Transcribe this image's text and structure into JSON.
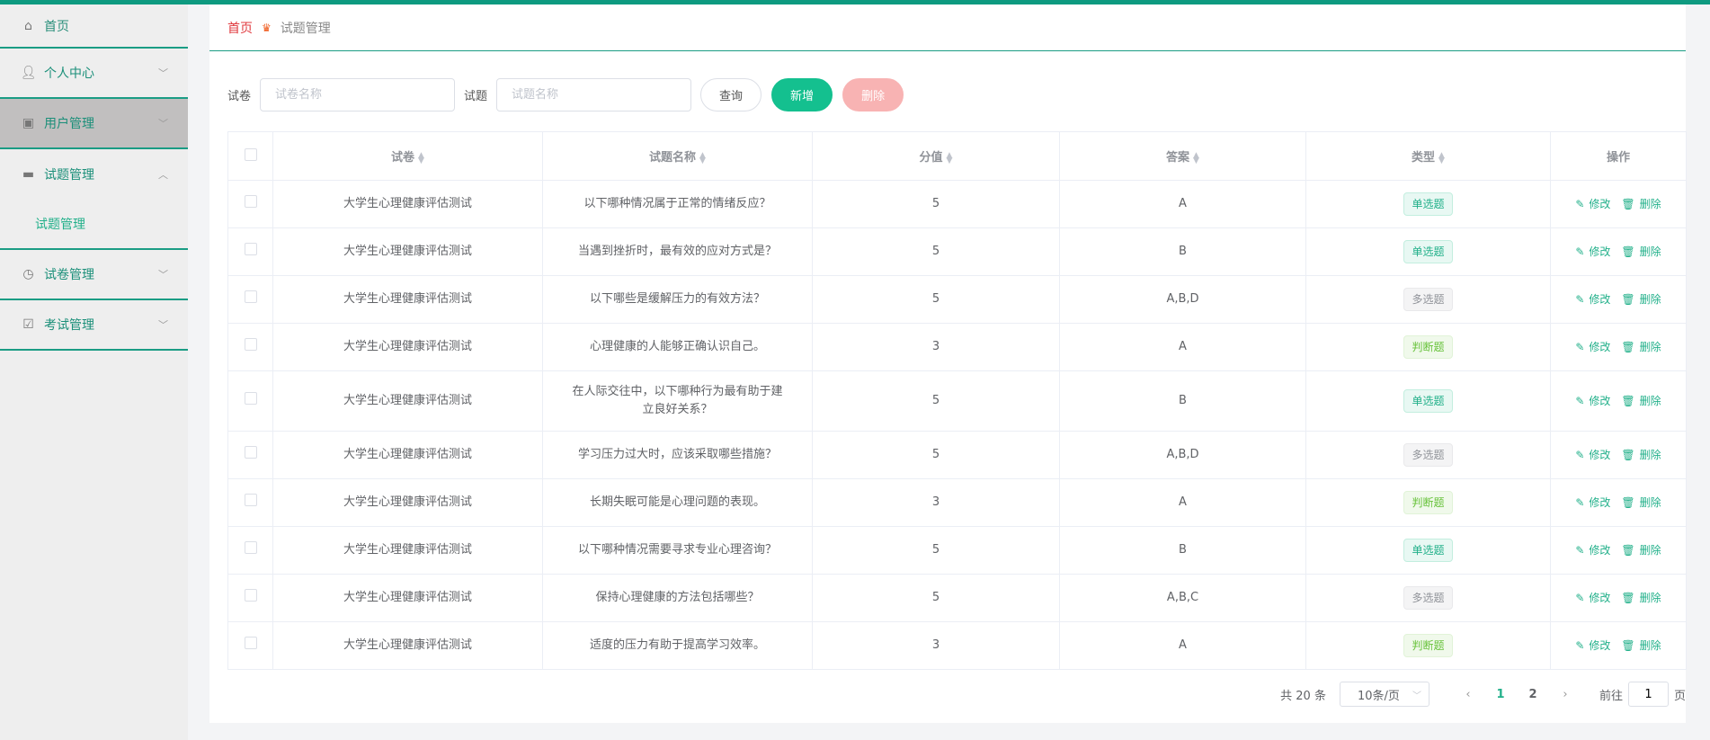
{
  "sidebar": {
    "items": [
      {
        "label": "首页",
        "icon": "home-icon"
      },
      {
        "label": "个人中心",
        "icon": "user-icon"
      },
      {
        "label": "用户管理",
        "icon": "clipboard-icon"
      },
      {
        "label": "试题管理",
        "icon": "briefcase-icon",
        "children": [
          {
            "label": "试题管理"
          }
        ]
      },
      {
        "label": "试卷管理",
        "icon": "gauge-icon"
      },
      {
        "label": "考试管理",
        "icon": "clipboard-check-icon"
      }
    ]
  },
  "breadcrumb": {
    "home": "首页",
    "current": "试题管理"
  },
  "search": {
    "paper_label": "试卷",
    "paper_placeholder": "试卷名称",
    "question_label": "试题",
    "question_placeholder": "试题名称",
    "query": "查询",
    "add": "新增",
    "delete": "删除"
  },
  "table": {
    "headers": [
      "试卷",
      "试题名称",
      "分值",
      "答案",
      "类型",
      "操作"
    ],
    "edit": "修改",
    "delete": "删除",
    "rows": [
      {
        "paper": "大学生心理健康评估测试",
        "question": "以下哪种情况属于正常的情绪反应？",
        "score": "5",
        "answer": "A",
        "type": "单选题",
        "kind": "single"
      },
      {
        "paper": "大学生心理健康评估测试",
        "question": "当遇到挫折时，最有效的应对方式是？",
        "score": "5",
        "answer": "B",
        "type": "单选题",
        "kind": "single"
      },
      {
        "paper": "大学生心理健康评估测试",
        "question": "以下哪些是缓解压力的有效方法？",
        "score": "5",
        "answer": "A,B,D",
        "type": "多选题",
        "kind": "multi"
      },
      {
        "paper": "大学生心理健康评估测试",
        "question": "心理健康的人能够正确认识自己。",
        "score": "3",
        "answer": "A",
        "type": "判断题",
        "kind": "judge"
      },
      {
        "paper": "大学生心理健康评估测试",
        "question": "在人际交往中，以下哪种行为最有助于建立良好关系？",
        "score": "5",
        "answer": "B",
        "type": "单选题",
        "kind": "single"
      },
      {
        "paper": "大学生心理健康评估测试",
        "question": "学习压力过大时，应该采取哪些措施？",
        "score": "5",
        "answer": "A,B,D",
        "type": "多选题",
        "kind": "multi"
      },
      {
        "paper": "大学生心理健康评估测试",
        "question": "长期失眠可能是心理问题的表现。",
        "score": "3",
        "answer": "A",
        "type": "判断题",
        "kind": "judge"
      },
      {
        "paper": "大学生心理健康评估测试",
        "question": "以下哪种情况需要寻求专业心理咨询？",
        "score": "5",
        "answer": "B",
        "type": "单选题",
        "kind": "single"
      },
      {
        "paper": "大学生心理健康评估测试",
        "question": "保持心理健康的方法包括哪些？",
        "score": "5",
        "answer": "A,B,C",
        "type": "多选题",
        "kind": "multi"
      },
      {
        "paper": "大学生心理健康评估测试",
        "question": "适度的压力有助于提高学习效率。",
        "score": "3",
        "answer": "A",
        "type": "判断题",
        "kind": "judge"
      }
    ]
  },
  "pagination": {
    "total": "共 20 条",
    "page_size": "10条/页",
    "pages": [
      "1",
      "2"
    ],
    "current": "1",
    "goto_label": "前往",
    "goto_value": "1",
    "page_suffix": "页"
  }
}
